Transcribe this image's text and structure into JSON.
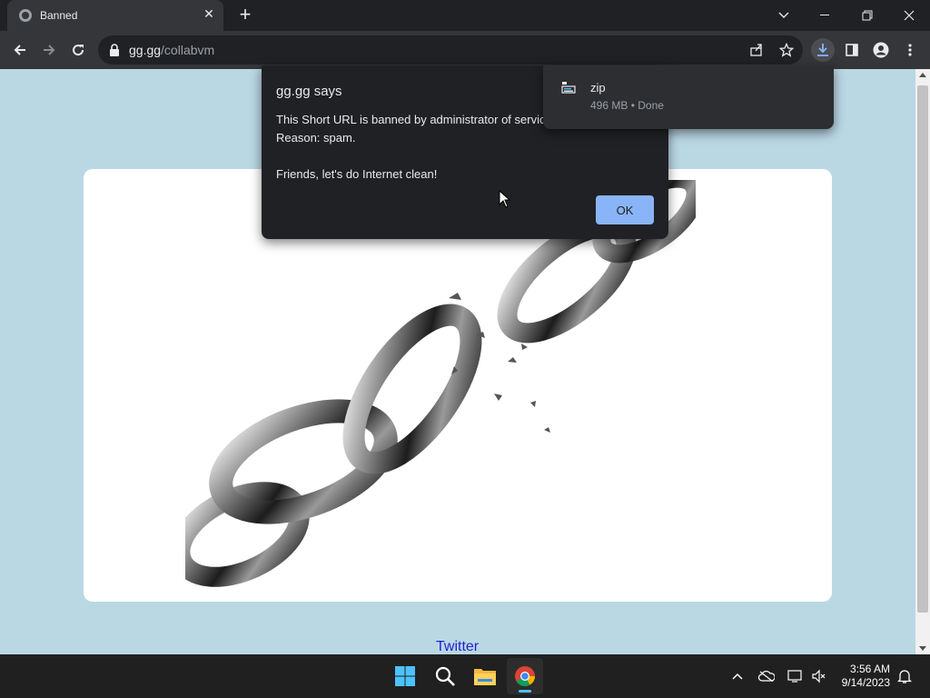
{
  "browser": {
    "tab_title": "Banned",
    "url_domain": "gg.gg",
    "url_path": "/collabvm"
  },
  "page": {
    "link_twitter": "Twitter"
  },
  "dialog": {
    "title": "gg.gg says",
    "message": "This Short URL is banned by administrator of service\nReason: spam.\n\nFriends, let's do Internet clean!",
    "ok_label": "OK"
  },
  "download": {
    "file_name": "zip",
    "status": "496 MB • Done"
  },
  "taskbar": {
    "time": "3:56 AM",
    "date": "9/14/2023"
  },
  "colors": {
    "page_bg": "#bad8e4",
    "accent": "#8ab4f8",
    "link": "#2222cc"
  }
}
